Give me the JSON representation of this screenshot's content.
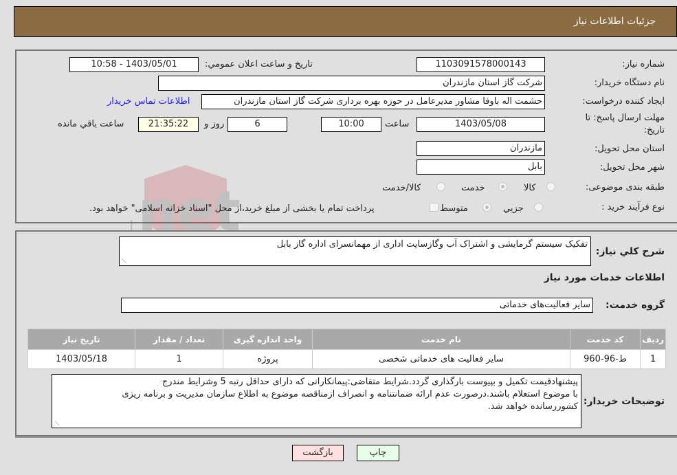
{
  "header": {
    "title": "جزئيات اطلاعات نياز"
  },
  "fields": {
    "need_number": {
      "label": "شماره نياز:",
      "value": "1103091578000143"
    },
    "announce_datetime": {
      "label": "تاريخ و ساعت اعلان عمومي:",
      "value": "1403/05/01 - 10:58"
    },
    "buyer_org": {
      "label": "نام دستگاه خريدار:",
      "value": "شرکت گاز استان مازندران"
    },
    "requester": {
      "label": "ايجاد کننده درخواست:",
      "value": "حشمت اله باوفا مشاور مديرعامل در حوزه بهره برداری  شرکت گاز استان مازندران"
    },
    "buyer_contact_link": "اطلاعات تماس خريدار",
    "deadline": {
      "label_line1": "مهلت ارسال پاسخ: تا",
      "label_line2": "تاريخ:",
      "date": "1403/05/08",
      "time_label": "ساعت",
      "time": "10:00",
      "days": "6",
      "days_label": "روز و",
      "remaining": "21:35:22",
      "remaining_label": "ساعت باقي مانده"
    },
    "province": {
      "label": "استان محل تحويل:",
      "value": "مازندران"
    },
    "city": {
      "label": "شهر محل تحويل:",
      "value": "بابل"
    },
    "category": {
      "label": "طبقه بندی موضوعی:",
      "options": [
        "کالا",
        "خدمت",
        "کالا/خدمت"
      ],
      "selected": "خدمت"
    },
    "purchase_type": {
      "label": "نوع فرآيند خريد :",
      "options": [
        "جزيي",
        "متوسط"
      ],
      "selected": "متوسط",
      "treasury_note": "پرداخت تمام يا بخشی از مبلغ خريد،از محل \"اسناد خزانه اسلامی\" خواهد بود."
    }
  },
  "description": {
    "label": "شرح کلي نياز:",
    "value": "تفکيک سيستم گرمايشی و اشتراک آب وگازسايت اداری از مهمانسرای اداره گاز بابل"
  },
  "services_section": {
    "title": "اطلاعات خدمات مورد نياز",
    "group_label": "گروه خدمت:",
    "group_value": "ساير فعاليت‌های خدماتی",
    "table": {
      "headers": [
        "رديف",
        "کد خدمت",
        "نام خدمت",
        "واحد اندازه گيری",
        "تعداد / مقدار",
        "تاريخ نياز"
      ],
      "rows": [
        [
          "1",
          "ط-96-960",
          "ساير فعاليت های خدماتی شخصی",
          "پروژه",
          "1",
          "1403/05/18"
        ]
      ]
    }
  },
  "buyer_notes": {
    "label": "توضيحات خريدار:",
    "lines": [
      "پيشنهادقيمت تکميل و بپيوست بارگذاری گردد.شرايط متقاضی:پيمانکارانی که دارای حداقل رتبه 5 وشرايط مندرج",
      " با موضوع استعلام باشند.درصورت عدم ارائه ضمانتنامه و انصراف ازمناقصه موضوع به اطلاع سازمان مديريت و برنامه ريزی",
      "کشوررسانده خواهد شد."
    ]
  },
  "buttons": {
    "print": "چاپ",
    "back": "بازگشت"
  },
  "watermark": {
    "text": "AriaTender.net"
  },
  "colors": {
    "header_bg": "#8b6c42",
    "link": "#1a1aff",
    "table_header_bg": "#a9a9a9",
    "back_btn_bg": "#ffe0e0",
    "print_btn_bg": "#e8ffe8",
    "remaining_bg": "#ffffe8"
  }
}
